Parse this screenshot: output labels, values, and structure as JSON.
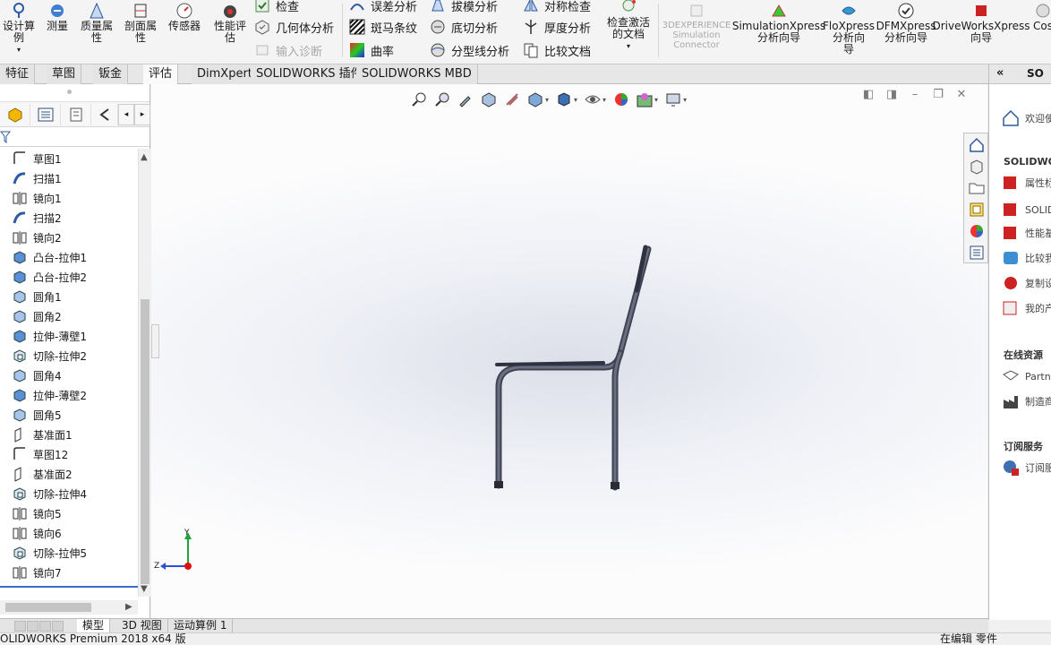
{
  "ribbon": {
    "design_study": "设计算\n例",
    "measure": "测量",
    "mass_properties": "质量属\n性",
    "section_properties": "剖面属\n性",
    "sensors": "传感器",
    "performance_eval": "性能评\n估",
    "check": "检查",
    "geometry_analysis": "几何体分析",
    "import_diagnostics": "输入诊断",
    "deviation_analysis": "误差分析",
    "zebra_stripes": "斑马条纹",
    "curvature": "曲率",
    "draft_analysis": "拔模分析",
    "undercut_analysis": "底切分析",
    "parting_line_analysis": "分型线分析",
    "symmetry_check": "对称检查",
    "thickness_analysis": "厚度分析",
    "compare_documents": "比较文档",
    "check_active_doc": "检查激活\n的文档",
    "experience_connector": "3DEXPERIENCE\nSimulation\nConnector",
    "simulation_xpress": "SimulationXpress\n分析向导",
    "flo_xpress": "FloXpress\n分析向\n导",
    "dfm_xpress": "DFMXpress\n分析向导",
    "driveworks_xpress": "DriveWorksXpress\n向导",
    "costing": "Cos"
  },
  "command_tabs": [
    "特征",
    "草图",
    "钣金",
    "评估",
    "DimXpert",
    "SOLIDWORKS 插件",
    "SOLIDWORKS MBD"
  ],
  "active_command_tab": "评估",
  "feature_tree": [
    {
      "label": "草图1",
      "icon": "sketch-icon"
    },
    {
      "label": "扫描1",
      "icon": "sweep-icon"
    },
    {
      "label": "镜向1",
      "icon": "mirror-icon"
    },
    {
      "label": "扫描2",
      "icon": "sweep-icon"
    },
    {
      "label": "镜向2",
      "icon": "mirror-icon"
    },
    {
      "label": "凸台-拉伸1",
      "icon": "boss-extrude-icon"
    },
    {
      "label": "凸台-拉伸2",
      "icon": "boss-extrude-icon"
    },
    {
      "label": "圆角1",
      "icon": "fillet-icon"
    },
    {
      "label": "圆角2",
      "icon": "fillet-icon"
    },
    {
      "label": "拉伸-薄壁1",
      "icon": "boss-extrude-icon"
    },
    {
      "label": "切除-拉伸2",
      "icon": "cut-extrude-icon"
    },
    {
      "label": "圆角4",
      "icon": "fillet-icon"
    },
    {
      "label": "拉伸-薄壁2",
      "icon": "boss-extrude-icon"
    },
    {
      "label": "圆角5",
      "icon": "fillet-icon"
    },
    {
      "label": "基准面1",
      "icon": "plane-icon"
    },
    {
      "label": "草图12",
      "icon": "sketch-icon"
    },
    {
      "label": "基准面2",
      "icon": "plane-icon"
    },
    {
      "label": "切除-拉伸4",
      "icon": "cut-extrude-icon"
    },
    {
      "label": "镜向5",
      "icon": "mirror-icon"
    },
    {
      "label": "镜向6",
      "icon": "mirror-icon"
    },
    {
      "label": "切除-拉伸5",
      "icon": "cut-extrude-icon"
    },
    {
      "label": "镜向7",
      "icon": "mirror-icon"
    }
  ],
  "bottom_tabs": [
    "模型",
    "3D 视图",
    "运动算例 1"
  ],
  "active_bottom_tab": "模型",
  "status_bar": {
    "left": "OLIDWORKS Premium 2018 x64 版",
    "right": "在编辑 零件"
  },
  "task_pane": {
    "title": "SO",
    "welcome": "欢迎使",
    "section_solidworks": "SOLIDWOR",
    "items": [
      "属性标",
      "SOLID",
      "性能基",
      "比较我",
      "复制设",
      "我的产"
    ],
    "section_online": "在线资源",
    "online_items": [
      "Partne",
      "制造商"
    ],
    "section_subscription": "订阅服务",
    "subscription_items": [
      "订阅服"
    ]
  },
  "triad": {
    "y": "Y",
    "z": "Z"
  },
  "colors": {
    "accent": "#3a6ec6",
    "model": "#4b5060"
  }
}
